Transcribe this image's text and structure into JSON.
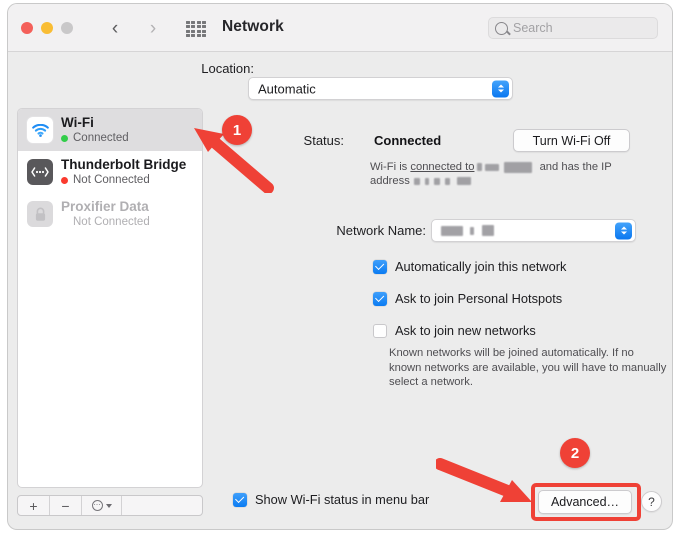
{
  "window": {
    "title": "Network",
    "traffic_lights": [
      "close",
      "minimize",
      "zoom"
    ],
    "back_label": "‹",
    "forward_label": "›",
    "grid_icon": "apps-grid-icon"
  },
  "search": {
    "placeholder": "Search",
    "value": "",
    "icon": "search-icon"
  },
  "location": {
    "label": "Location:",
    "selected": "Automatic"
  },
  "sidebar": {
    "services": [
      {
        "name": "Wi-Fi",
        "status": "Connected",
        "status_color": "#32cd4a",
        "icon": "wifi-icon",
        "selected": true,
        "dimmed": false
      },
      {
        "name": "Thunderbolt Bridge",
        "status": "Not Connected",
        "status_color": "#fa3a2e",
        "icon": "thunderbolt-bridge-icon",
        "selected": false,
        "dimmed": false
      },
      {
        "name": "Proxifier Data",
        "status": "Not Connected",
        "status_color": "",
        "icon": "lock-icon",
        "selected": false,
        "dimmed": true
      }
    ],
    "footer": {
      "add_label": "+",
      "remove_label": "−",
      "actions_label": "⋯"
    }
  },
  "main": {
    "status_label": "Status:",
    "status_value": "Connected",
    "turn_off_button": "Turn Wi-Fi Off",
    "status_description_part1": "Wi-Fi is ",
    "status_description_link": "connected to",
    "status_description_part2": " and has the IP",
    "status_description_part3": "address",
    "network_name_label": "Network Name:",
    "network_name_value": "",
    "checkboxes": [
      {
        "label": "Automatically join this network",
        "checked": true
      },
      {
        "label": "Ask to join Personal Hotspots",
        "checked": true
      },
      {
        "label": "Ask to join new networks",
        "checked": false
      }
    ],
    "help_note": "Known networks will be joined automatically. If no known networks are available, you will have to manually select a network.",
    "show_status_checkbox": {
      "label": "Show Wi-Fi status in menu bar",
      "checked": true
    },
    "advanced_button": "Advanced…",
    "help_button": "?"
  },
  "annotations": {
    "badges": [
      {
        "number": "1",
        "target": "wifi-sidebar-item"
      },
      {
        "number": "2",
        "target": "advanced-button"
      }
    ],
    "highlight_color": "#ef4136"
  }
}
